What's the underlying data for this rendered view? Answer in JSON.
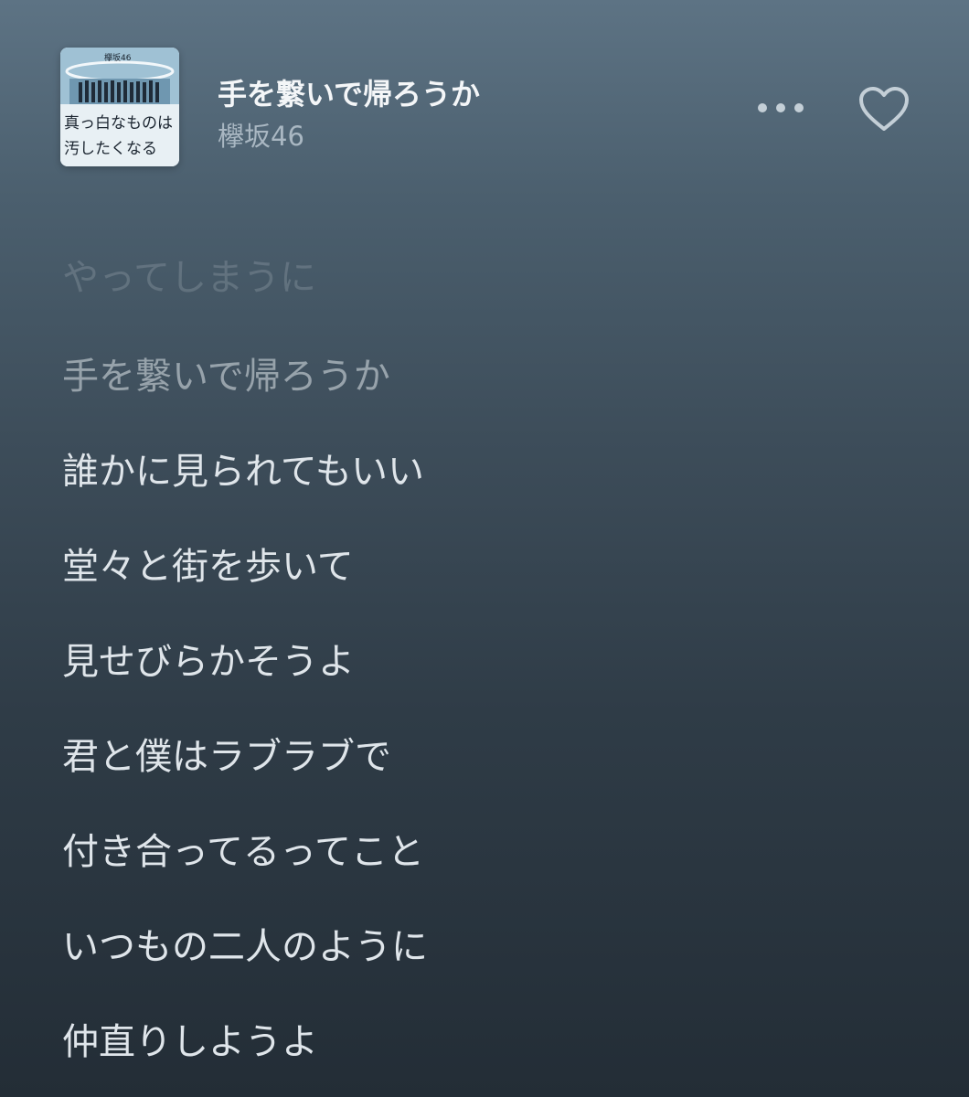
{
  "now_playing": {
    "title": "手を繋いで帰ろうか",
    "artist": "欅坂46",
    "artwork": {
      "group_text": "欅坂46",
      "album_text_line1": "真っ白なものは",
      "album_text_line2": "汚したくなる"
    }
  },
  "controls": {
    "more_icon": "ellipsis-icon",
    "favorite_icon": "heart-outline-icon"
  },
  "lyrics": [
    {
      "text": "やってしまうに",
      "state": "faded"
    },
    {
      "text": "手を繋いで帰ろうか",
      "state": "past"
    },
    {
      "text": "誰かに見られてもいい",
      "state": "upcoming"
    },
    {
      "text": "堂々と街を歩いて",
      "state": "upcoming"
    },
    {
      "text": "見せびらかそうよ",
      "state": "upcoming"
    },
    {
      "text": "君と僕はラブラブで",
      "state": "upcoming"
    },
    {
      "text": "付き合ってるってこと",
      "state": "upcoming"
    },
    {
      "text": "いつもの二人のように",
      "state": "upcoming"
    },
    {
      "text": "仲直りしようよ",
      "state": "upcoming"
    }
  ]
}
